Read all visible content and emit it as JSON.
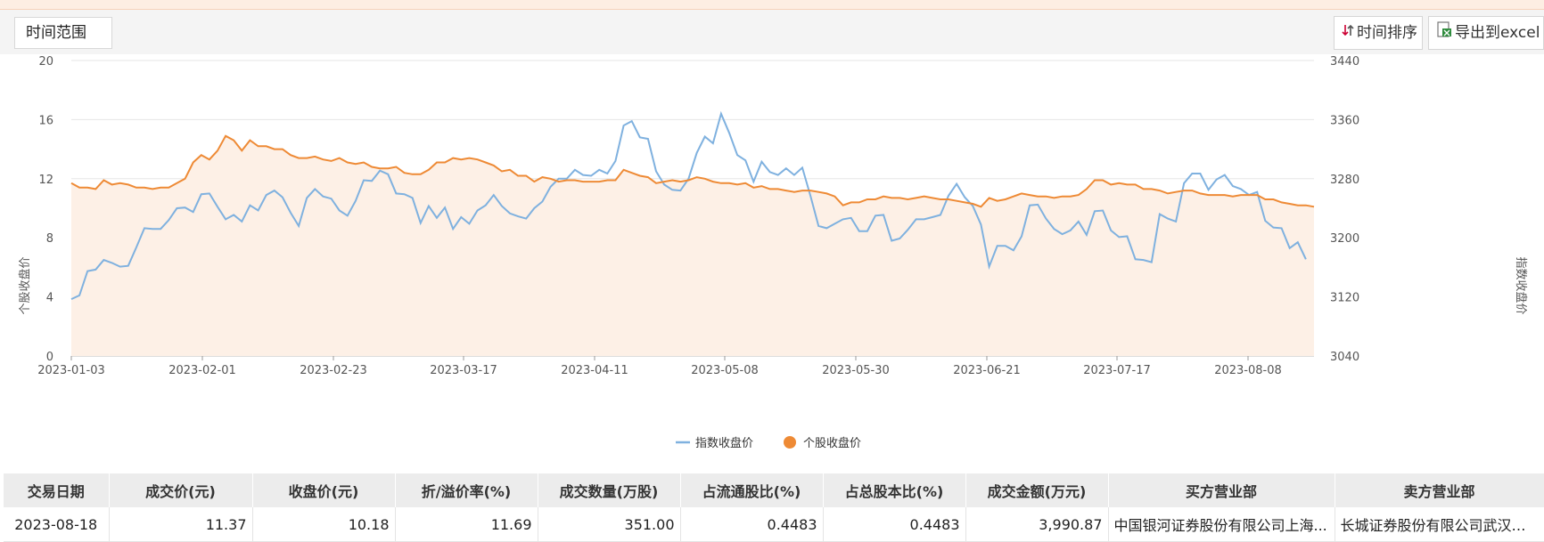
{
  "toolbar": {
    "time_range_label": "时间范围",
    "sort_label": "时间排序",
    "export_label": "导出到excel"
  },
  "colors": {
    "index_line": "#7fb1df",
    "stock_line": "#ee8a35",
    "stock_area": "#fdf0e6"
  },
  "chart_data": {
    "type": "line",
    "x_ticks": [
      "2023-01-03",
      "2023-02-01",
      "2023-02-23",
      "2023-03-17",
      "2023-04-11",
      "2023-05-08",
      "2023-05-30",
      "2023-06-21",
      "2023-07-17",
      "2023-08-08"
    ],
    "left_axis": {
      "label": "个股收盘价",
      "ticks": [
        0,
        4,
        8,
        12,
        16,
        20
      ],
      "range": [
        0,
        20
      ]
    },
    "right_axis": {
      "label": "指数收盘价",
      "ticks": [
        3040,
        3120,
        3200,
        3280,
        3360,
        3440
      ],
      "range": [
        3040,
        3440
      ]
    },
    "legend": [
      "指数收盘价",
      "个股收盘价"
    ],
    "series": [
      {
        "name": "指数收盘价",
        "axis": "right",
        "values": [
          3117,
          3122,
          3155,
          3157,
          3170,
          3166,
          3161,
          3162,
          3187,
          3213,
          3212,
          3212,
          3224,
          3240,
          3241,
          3235,
          3259,
          3260,
          3242,
          3225,
          3231,
          3222,
          3244,
          3237,
          3258,
          3264,
          3255,
          3234,
          3216,
          3254,
          3266,
          3256,
          3253,
          3237,
          3230,
          3250,
          3278,
          3277,
          3291,
          3286,
          3260,
          3259,
          3254,
          3220,
          3243,
          3227,
          3241,
          3212,
          3228,
          3219,
          3237,
          3244,
          3258,
          3243,
          3233,
          3229,
          3226,
          3240,
          3249,
          3269,
          3280,
          3280,
          3292,
          3285,
          3284,
          3292,
          3287,
          3304,
          3352,
          3358,
          3336,
          3334,
          3290,
          3272,
          3265,
          3264,
          3280,
          3315,
          3337,
          3328,
          3368,
          3342,
          3312,
          3305,
          3276,
          3303,
          3289,
          3285,
          3294,
          3285,
          3295,
          3257,
          3216,
          3213,
          3219,
          3225,
          3227,
          3209,
          3209,
          3230,
          3231,
          3196,
          3199,
          3211,
          3225,
          3225,
          3228,
          3231,
          3257,
          3273,
          3255,
          3243,
          3218,
          3161,
          3189,
          3189,
          3183,
          3202,
          3244,
          3245,
          3226,
          3212,
          3205,
          3210,
          3222,
          3204,
          3236,
          3237,
          3210,
          3201,
          3202,
          3171,
          3170,
          3167,
          3232,
          3226,
          3222,
          3274,
          3287,
          3287,
          3265,
          3279,
          3285,
          3270,
          3266,
          3258,
          3262,
          3223,
          3214,
          3213,
          3186,
          3194,
          3171
        ],
        "note_unused": ""
      },
      {
        "name": "个股收盘价",
        "axis": "left",
        "values": [
          11.7,
          11.4,
          11.4,
          11.3,
          11.9,
          11.6,
          11.7,
          11.6,
          11.4,
          11.4,
          11.3,
          11.4,
          11.4,
          11.7,
          12.0,
          13.1,
          13.6,
          13.3,
          13.9,
          14.9,
          14.6,
          13.9,
          14.6,
          14.2,
          14.2,
          14.0,
          14.0,
          13.6,
          13.4,
          13.4,
          13.5,
          13.3,
          13.2,
          13.4,
          13.1,
          13.0,
          13.1,
          12.8,
          12.7,
          12.7,
          12.8,
          12.4,
          12.3,
          12.3,
          12.6,
          13.1,
          13.1,
          13.4,
          13.3,
          13.4,
          13.3,
          13.1,
          12.9,
          12.5,
          12.6,
          12.2,
          12.2,
          11.8,
          12.1,
          12.0,
          11.8,
          11.9,
          11.9,
          11.8,
          11.8,
          11.8,
          11.9,
          11.9,
          12.6,
          12.4,
          12.2,
          12.1,
          11.7,
          11.8,
          11.9,
          11.8,
          11.9,
          12.1,
          12.0,
          11.8,
          11.7,
          11.7,
          11.6,
          11.7,
          11.4,
          11.5,
          11.3,
          11.3,
          11.2,
          11.1,
          11.2,
          11.2,
          11.1,
          11.0,
          10.8,
          10.2,
          10.4,
          10.4,
          10.6,
          10.6,
          10.8,
          10.7,
          10.7,
          10.6,
          10.7,
          10.8,
          10.7,
          10.6,
          10.6,
          10.5,
          10.4,
          10.3,
          10.1,
          10.7,
          10.5,
          10.6,
          10.8,
          11.0,
          10.9,
          10.8,
          10.8,
          10.7,
          10.8,
          10.8,
          10.9,
          11.3,
          11.9,
          11.9,
          11.6,
          11.7,
          11.6,
          11.6,
          11.3,
          11.3,
          11.2,
          11.0,
          11.1,
          11.2,
          11.2,
          11.0,
          10.9,
          10.9,
          10.9,
          10.8,
          10.9,
          10.9,
          10.9,
          10.6,
          10.6,
          10.4,
          10.3,
          10.2,
          10.2,
          10.1
        ]
      }
    ]
  },
  "table": {
    "headers": [
      "交易日期",
      "成交价(元)",
      "收盘价(元)",
      "折/溢价率(%)",
      "成交数量(万股)",
      "占流通股比(%)",
      "占总股本比(%)",
      "成交金额(万元)",
      "买方营业部",
      "卖方营业部"
    ],
    "rows": [
      [
        "2023-08-18",
        "11.37",
        "10.18",
        "11.69",
        "351.00",
        "0.4483",
        "0.4483",
        "3,990.87",
        "中国银河证券股份有限公司上海...",
        "长城证券股份有限公司武汉杨..."
      ]
    ]
  }
}
